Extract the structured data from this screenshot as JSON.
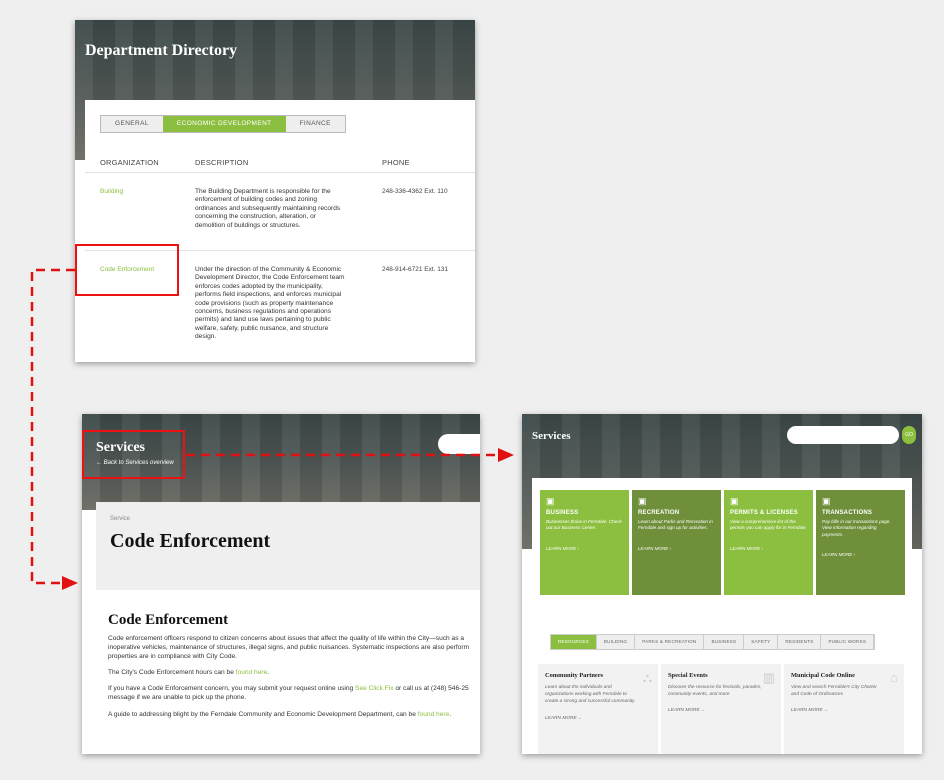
{
  "directory": {
    "title": "Department Directory",
    "tabs": [
      "GENERAL",
      "ECONOMIC DEVELOPMENT",
      "FINANCE"
    ],
    "active_tab": "ECONOMIC DEVELOPMENT",
    "columns": [
      "ORGANIZATION",
      "DESCRIPTION",
      "PHONE"
    ],
    "rows": [
      {
        "org": "Building",
        "desc_lines": [
          "The Building Department is responsible for the",
          "enforcement of building codes and zoning",
          "ordinances and subsequently maintaining records",
          "concerning the construction, alteration, or",
          "demolition of buildings or structures."
        ],
        "phone": "248-336-4362 Ext. 110"
      },
      {
        "org": "Code Enforcement",
        "desc_lines": [
          "Under the direction of the Community & Economic",
          "Development Director, the Code Enforcement team",
          "enforces codes adopted by the municipality,",
          "performs field inspections, and enforces municipal",
          "code provisions (such as property maintenance",
          "concerns, business regulations and operations",
          "permits) and land use laws pertaining to public",
          "welfare, safety, public nuisance, and structure",
          "design."
        ],
        "phone": "248-914-6721 Ext. 131"
      }
    ]
  },
  "service_page": {
    "section": "Services",
    "back_link": "← Back to Services overview",
    "label": "Service",
    "heading": "Code Enforcement",
    "subheading": "Code Enforcement",
    "para1_lines": [
      "Code enforcement officers respond to citizen concerns about issues that affect the quality of life within the City—such as a",
      "inoperative vehicles, maintenance of structures, illegal signs, and public nuisances. Systematic inspections are also perform",
      "properties are in compliance with City Code."
    ],
    "hours_text": "The City's Code Enforcement hours can be ",
    "hours_link": "found here",
    "concern_text": "If you have a Code Enforcement concern, you may submit your request online using ",
    "concern_link": "See Click Fix",
    "concern_text2": " or call us at (248) 546-25",
    "concern_line2": "message if we are unable to pick up the phone.",
    "blight_text": "A guide to addressing blight by the Ferndale Community and Economic Development Department, can be ",
    "blight_link": "found here"
  },
  "services_overview": {
    "title": "Services",
    "search_button": "GO",
    "tiles": [
      {
        "title": "BUSINESS",
        "desc": "Businesses thrive in Ferndale. Check out our Business Center.",
        "link": "LEARN MORE ›",
        "color": "#8cbf3f",
        "icon": "building-icon"
      },
      {
        "title": "RECREATION",
        "desc": "Learn about Parks and Recreation in Ferndale and sign up for activities.",
        "link": "LEARN MORE ›",
        "color": "#6f8f3a",
        "icon": "building-icon"
      },
      {
        "title": "PERMITS & LICENSES",
        "desc": "View a comprehensive list of the permits you can apply for in Ferndale.",
        "link": "LEARN MORE ›",
        "color": "#8cbf3f",
        "icon": "building-icon"
      },
      {
        "title": "TRANSACTIONS",
        "desc": "Pay bills in our transactions page. View information regarding payments.",
        "link": "LEARN MORE ›",
        "color": "#6f8f3a",
        "icon": "building-icon"
      }
    ],
    "tabs": [
      "RESOURCES",
      "BUILDING",
      "PARKS & RECREATION",
      "BUSINESS",
      "SAFETY",
      "RESIDENTS",
      "PUBLIC WORKS"
    ],
    "active_tab": "RESOURCES",
    "cards": [
      {
        "title": "Community Partners",
        "desc": "Learn about the individuals and organizations working with Ferndale to create a strong and successful community",
        "link": "LEARN MORE→",
        "icon": "people-icon"
      },
      {
        "title": "Special Events",
        "desc": "Discover the resource for festivals, parades, community events, and more",
        "link": "LEARN MORE→",
        "icon": "map-icon"
      },
      {
        "title": "Municipal Code Online",
        "desc": "View and search Ferndale's City Charter and Code of Ordinances",
        "link": "LEARN MORE→",
        "icon": "courthouse-icon"
      }
    ]
  },
  "annotation_color": "#e11111"
}
